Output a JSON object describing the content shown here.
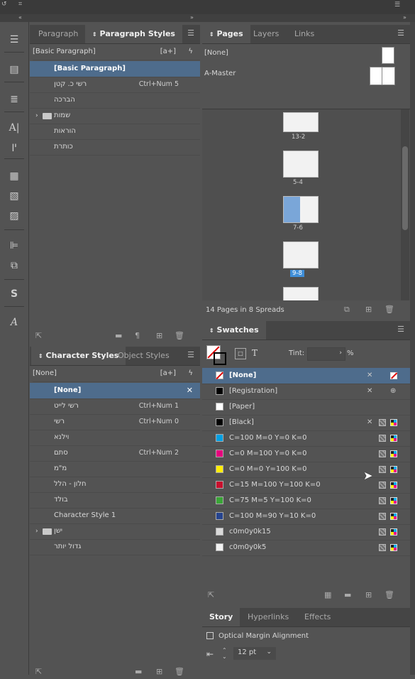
{
  "paragraph_panel": {
    "tabs": [
      "Paragraph",
      "Paragraph Styles"
    ],
    "current_style": "[Basic Paragraph]",
    "new_style_btn": "[a+]",
    "styles": [
      {
        "name": "[Basic Paragraph]",
        "shortcut": ""
      },
      {
        "name": "רשי כ. קטן",
        "shortcut": "Ctrl+Num 5"
      },
      {
        "name": "הברכה",
        "shortcut": ""
      },
      {
        "name": "שמות",
        "shortcut": "",
        "group": true
      },
      {
        "name": "הוראות",
        "shortcut": ""
      },
      {
        "name": "כותרת",
        "shortcut": ""
      }
    ]
  },
  "character_panel": {
    "tabs": [
      "Character Styles",
      "Object Styles"
    ],
    "current_style": "[None]",
    "new_style_btn": "[a+]",
    "styles": [
      {
        "name": "[None]",
        "shortcut": ""
      },
      {
        "name": "רשי לייט",
        "shortcut": "Ctrl+Num 1"
      },
      {
        "name": "רשי",
        "shortcut": "Ctrl+Num 0"
      },
      {
        "name": "וילנא",
        "shortcut": ""
      },
      {
        "name": "סתם",
        "shortcut": "Ctrl+Num 2"
      },
      {
        "name": "מ\"מ",
        "shortcut": ""
      },
      {
        "name": "חלון - הלל",
        "shortcut": ""
      },
      {
        "name": "בולד",
        "shortcut": ""
      },
      {
        "name": "Character Style 1",
        "shortcut": ""
      },
      {
        "name": "ישן",
        "shortcut": "",
        "group": true
      },
      {
        "name": "גדול יותר",
        "shortcut": ""
      }
    ]
  },
  "pages_panel": {
    "tabs": [
      "Pages",
      "Layers",
      "Links"
    ],
    "masters": [
      "[None]",
      "A-Master"
    ],
    "spreads": [
      {
        "label": "13-2"
      },
      {
        "label": "5-4"
      },
      {
        "label": "7-6"
      },
      {
        "label": "9-8",
        "selected": true
      }
    ],
    "status": "14 Pages in 8 Spreads"
  },
  "swatches_panel": {
    "tab": "Swatches",
    "tint_label": "Tint:",
    "tint_unit": "%",
    "text_mode": "T",
    "swatches": [
      {
        "name": "[None]",
        "color": "none",
        "selected": true
      },
      {
        "name": "[Registration]",
        "color": "#000000"
      },
      {
        "name": "[Paper]",
        "color": "#ffffff"
      },
      {
        "name": "[Black]",
        "color": "#000000"
      },
      {
        "name": "C=100 M=0 Y=0 K=0",
        "color": "#00a0e3"
      },
      {
        "name": "C=0 M=100 Y=0 K=0",
        "color": "#e6007e"
      },
      {
        "name": "C=0 M=0 Y=100 K=0",
        "color": "#ffed00"
      },
      {
        "name": "C=15 M=100 Y=100 K=0",
        "color": "#c8102e"
      },
      {
        "name": "C=75 M=5 Y=100 K=0",
        "color": "#3aa537"
      },
      {
        "name": "C=100 M=90 Y=10 K=0",
        "color": "#26448f"
      },
      {
        "name": "c0m0y0k15",
        "color": "#dadada"
      },
      {
        "name": "c0m0y0k5",
        "color": "#f2f2f2"
      }
    ]
  },
  "story_panel": {
    "tabs": [
      "Story",
      "Hyperlinks",
      "Effects"
    ],
    "optical_margin": "Optical Margin Alignment",
    "size_value": "12 pt"
  }
}
